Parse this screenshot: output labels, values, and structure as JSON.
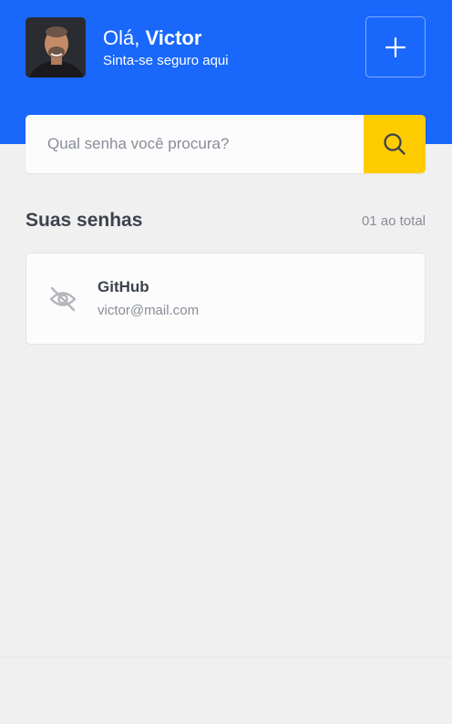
{
  "header": {
    "greeting_prefix": "Olá, ",
    "user_name": "Victor",
    "subtitle": "Sinta-se seguro aqui",
    "brand_color": "#1967fb",
    "avatar_icon": "user-avatar-photo",
    "add_icon": "plus-icon"
  },
  "search": {
    "placeholder": "Qual senha você procura?",
    "value": "",
    "button_icon": "search-icon",
    "button_color": "#ffcc00"
  },
  "passwords": {
    "title": "Suas senhas",
    "count_label": "01 ao total",
    "items": [
      {
        "title": "GitHub",
        "email": "victor@mail.com",
        "icon": "eye-off-icon"
      }
    ]
  }
}
